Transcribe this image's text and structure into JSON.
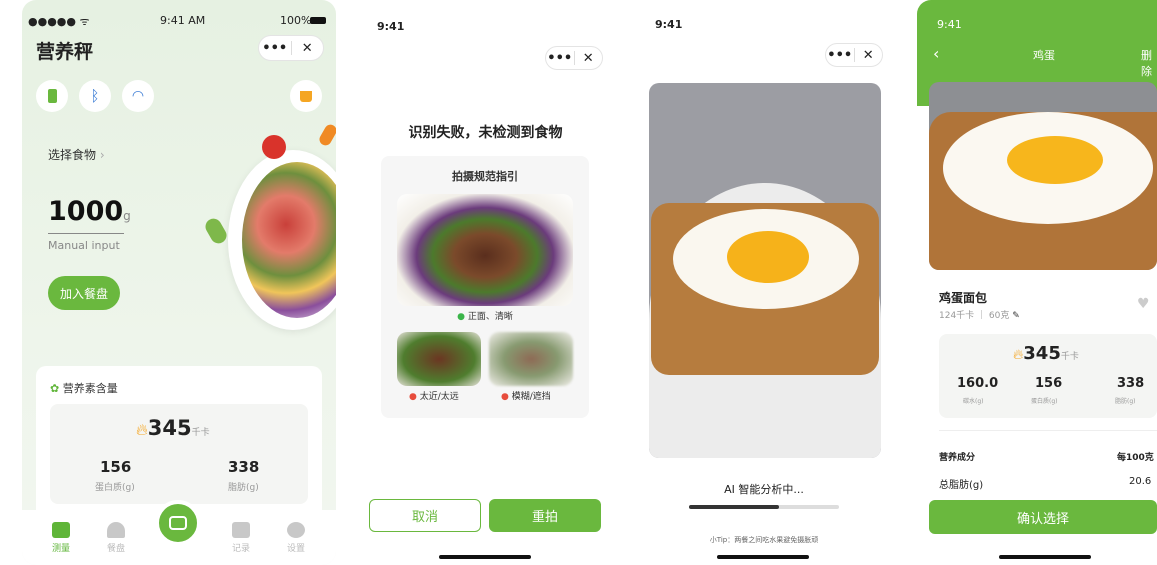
{
  "phone1": {
    "status_left": "●●●●● ᯤ",
    "status_time": "9:41 AM",
    "status_battery": "100%",
    "title": "营养秤",
    "menu_more": "•••",
    "menu_close": "✕",
    "select_food": "选择食物",
    "weight_value": "1000",
    "weight_unit": "g",
    "manual_input": "Manual input",
    "add_button": "加入餐盘",
    "nutrients_title": "营养素含量",
    "calories": "345",
    "calories_unit": "千卡",
    "protein_value": "156",
    "protein_label": "蛋白质(g)",
    "fat_value": "338",
    "fat_label": "脂肪(g)",
    "tabs": [
      "测量",
      "餐盘",
      "记录",
      "设置"
    ]
  },
  "phone2": {
    "status_time": "9:41",
    "menu_more": "•••",
    "menu_close": "✕",
    "title": "识别失败，未检测到食物",
    "guide_title": "拍摄规范指引",
    "good_label": "正面、清晰",
    "bad1_label": "太近/太远",
    "bad2_label": "模糊/遮挡",
    "cancel": "取消",
    "retake": "重拍"
  },
  "phone3": {
    "status_time": "9:41",
    "menu_more": "•••",
    "menu_close": "✕",
    "analyzing": "AI 智能分析中...",
    "progress": 0.6,
    "tip": "小Tip：两餐之间吃水果避免摄胀顽"
  },
  "phone4": {
    "status_time": "9:41",
    "back": "‹",
    "title": "鸡蛋",
    "delete": "删除",
    "food_name": "鸡蛋面包",
    "food_sub": "124千卡 ｜ 60克",
    "calories": "345",
    "calories_unit": "千卡",
    "water_value": "160.0",
    "water_label": "碳水(g)",
    "protein_value": "156",
    "protein_label": "蛋白质(g)",
    "fat_value": "338",
    "fat_label": "脂肪(g)",
    "nutrition_label": "营养成分",
    "per_label": "每100克",
    "total_fat_label": "总脂肪(g)",
    "total_fat_value": "20.6",
    "confirm": "确认选择"
  },
  "colors": {
    "accent": "#6ab83e",
    "flame": "#f5a623"
  }
}
